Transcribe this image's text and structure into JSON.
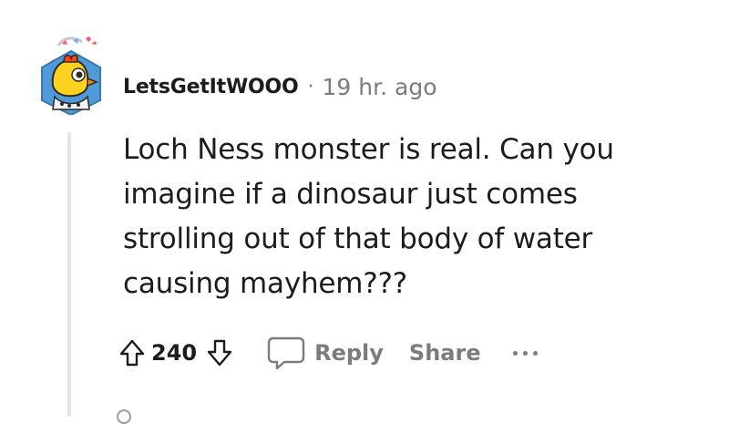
{
  "comment": {
    "username": "LetsGetItWOOO",
    "separator": "·",
    "timestamp": "19 hr. ago",
    "body": "Loch Ness monster is real. Can you imagine if a dinosaur just comes strolling out of that body of water causing mayhem???",
    "score": "240",
    "reply_label": "Reply",
    "share_label": "Share"
  },
  "icons": {
    "upvote": "upvote-arrow-icon",
    "downvote": "downvote-arrow-icon",
    "reply": "speech-bubble-icon",
    "more": "ellipsis-icon"
  },
  "colors": {
    "text": "#1c1c1c",
    "muted": "#7c7c7c",
    "thread_line": "#e5e7e9",
    "avatar_bg": "#4f9bd9",
    "avatar_chicken": "#ffd21f",
    "avatar_comb": "#ff4500"
  }
}
